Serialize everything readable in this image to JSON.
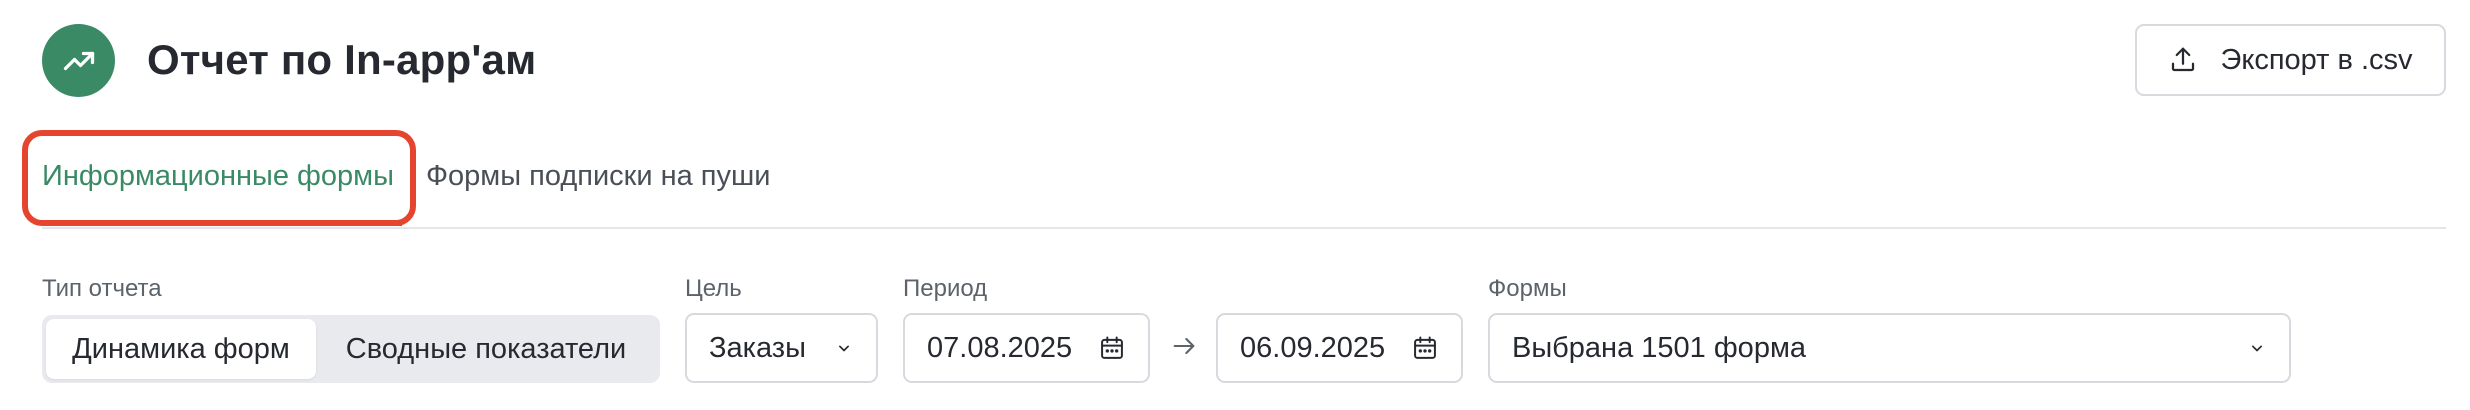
{
  "header": {
    "logo_icon": "trending-up-icon",
    "title": "Отчет по In-app'ам",
    "export_label": "Экспорт в .csv",
    "export_icon": "upload-icon"
  },
  "tabs": [
    {
      "label": "Информационные формы",
      "active": true
    },
    {
      "label": "Формы подписки на пуши",
      "active": false
    }
  ],
  "filters": {
    "report_type": {
      "label": "Тип отчета",
      "options": [
        "Динамика форм",
        "Сводные показатели"
      ],
      "selected": "Динамика форм"
    },
    "goal": {
      "label": "Цель",
      "value": "Заказы"
    },
    "period": {
      "label": "Период",
      "from": "07.08.2025",
      "to": "06.09.2025"
    },
    "forms": {
      "label": "Формы",
      "value": "Выбрана 1501 форма"
    }
  },
  "colors": {
    "accent": "#3b8a66",
    "highlight": "#e5442f",
    "border": "#d6d9de",
    "segment_bg": "#e8eaed"
  }
}
